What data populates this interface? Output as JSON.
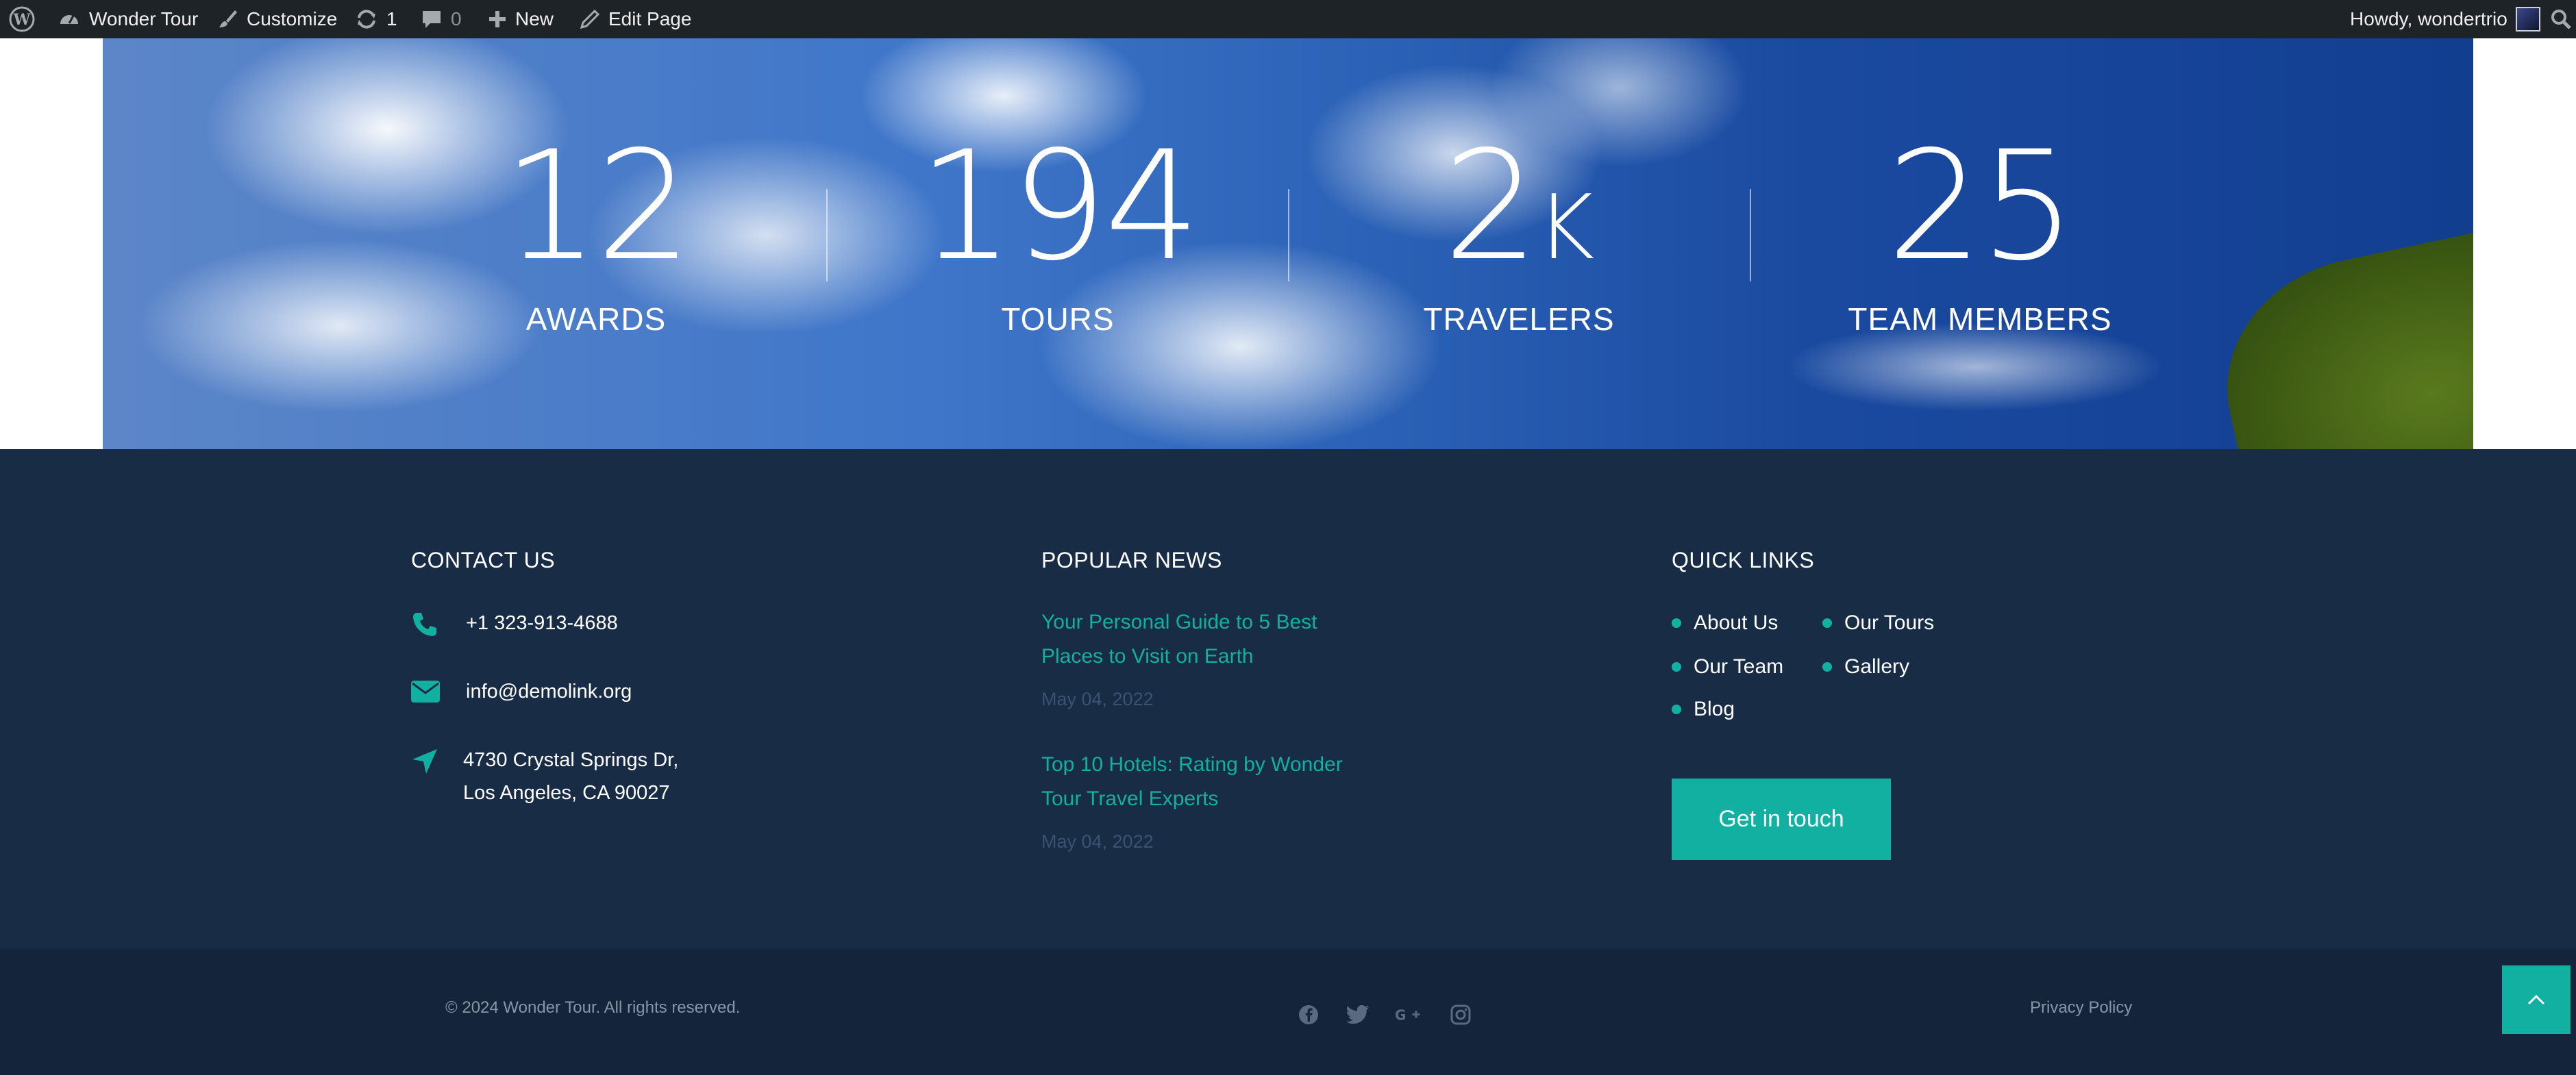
{
  "admin_bar": {
    "site_name": "Wonder Tour",
    "customize": "Customize",
    "updates_count": "1",
    "comments_count": "0",
    "new_label": "New",
    "edit_page": "Edit Page",
    "howdy": "Howdy, wondertrio"
  },
  "stats": [
    {
      "number": "12",
      "suffix": "",
      "label": "AWARDS"
    },
    {
      "number": "194",
      "suffix": "",
      "label": "TOURS"
    },
    {
      "number": "2",
      "suffix": "K",
      "label": "TRAVELERS"
    },
    {
      "number": "25",
      "suffix": "",
      "label": "TEAM MEMBERS"
    }
  ],
  "footer": {
    "contact": {
      "title": "CONTACT US",
      "phone": "+1 323-913-4688",
      "email": "info@demolink.org",
      "address_line1": "4730 Crystal Springs Dr,",
      "address_line2": "Los Angeles, CA 90027"
    },
    "news": {
      "title": "POPULAR NEWS",
      "items": [
        {
          "title": "Your Personal Guide to 5 Best Places to Visit on Earth",
          "date": "May 04, 2022"
        },
        {
          "title": "Top 10 Hotels: Rating by Wonder Tour Travel Experts",
          "date": "May 04, 2022"
        }
      ]
    },
    "quick_links": {
      "title": "QUICK LINKS",
      "items": [
        "About Us",
        "Our Tours",
        "Our Team",
        "Gallery",
        "Blog"
      ],
      "cta": "Get in touch"
    }
  },
  "bottom": {
    "copyright": "© 2024 Wonder Tour. All rights reserved.",
    "privacy": "Privacy Policy",
    "social_icons": [
      "facebook-icon",
      "twitter-icon",
      "google-plus-icon",
      "instagram-icon"
    ]
  },
  "colors": {
    "accent": "#12b0a0",
    "footer_bg": "#182c45",
    "bottom_bg": "#13243b",
    "admin_bar_bg": "#1d2327"
  }
}
